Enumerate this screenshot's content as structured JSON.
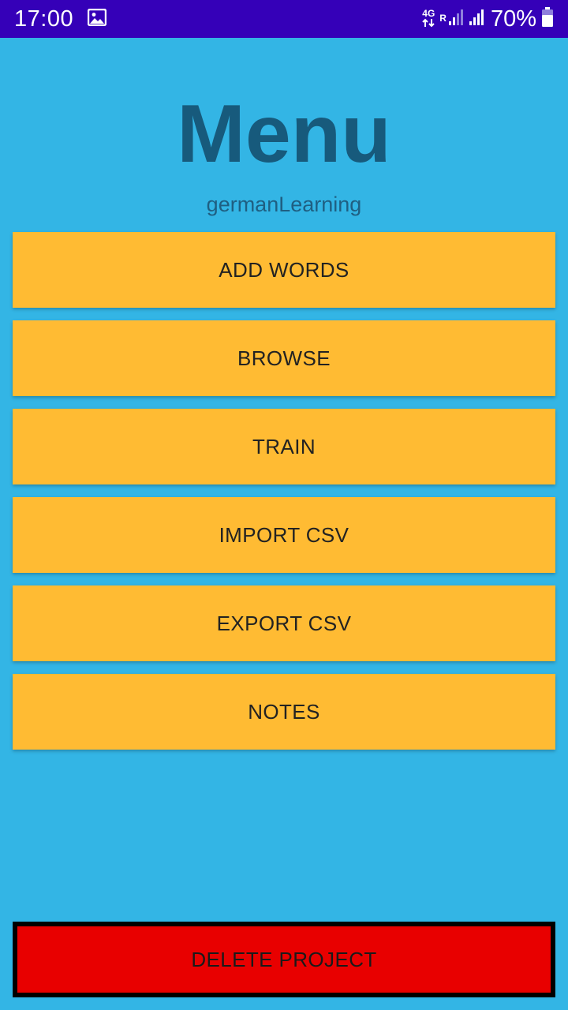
{
  "status_bar": {
    "time": "17:00",
    "network": "4G",
    "roaming": "R",
    "battery": "70%"
  },
  "header": {
    "title": "Menu",
    "project_name": "germanLearning"
  },
  "menu": {
    "add_words": "ADD WORDS",
    "browse": "BROWSE",
    "train": "TRAIN",
    "import_csv": "IMPORT CSV",
    "export_csv": "EXPORT CSV",
    "notes": "NOTES"
  },
  "delete_label": "DELETE PROJECT",
  "colors": {
    "background": "#33b5e5",
    "status_bar": "#3500b8",
    "menu_button": "#ffbb33",
    "delete_button": "#e80000"
  },
  "icons": {
    "status_left": "image-icon",
    "status_right": [
      "data-arrows-icon",
      "signal-icon",
      "battery-icon"
    ]
  }
}
